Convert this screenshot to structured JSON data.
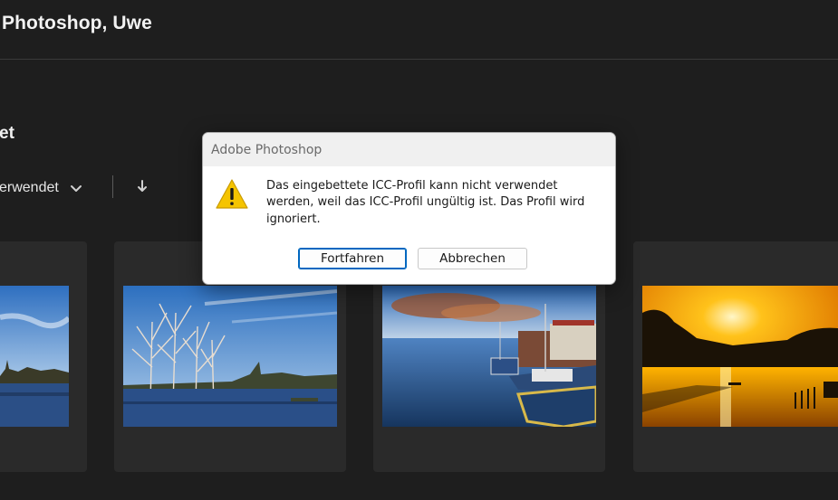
{
  "header": {
    "greeting": "Photoshop, Uwe"
  },
  "section": {
    "title": "et",
    "sort_label": "erwendet",
    "sort_direction_icon": "arrow-down-icon"
  },
  "recent_files": [
    {
      "thumbnail": "lake-village-skyline"
    },
    {
      "thumbnail": "bare-trees-in-flooded-lake"
    },
    {
      "thumbnail": "harbor-with-boats-sunset"
    },
    {
      "thumbnail": "golden-sunset-over-water-rower"
    }
  ],
  "dialog": {
    "title": "Adobe Photoshop",
    "icon": "warning-icon",
    "message": "Das eingebettete ICC-Profil kann nicht verwendet werden, weil das ICC-Profil ungültig ist. Das Profil wird ignoriert.",
    "primary_button": "Fortfahren",
    "secondary_button": "Abbrechen"
  },
  "colors": {
    "background": "#1e1e1e",
    "card": "#2a2a2a",
    "dialog_accent": "#0067c0",
    "warning": "#f5c400"
  }
}
